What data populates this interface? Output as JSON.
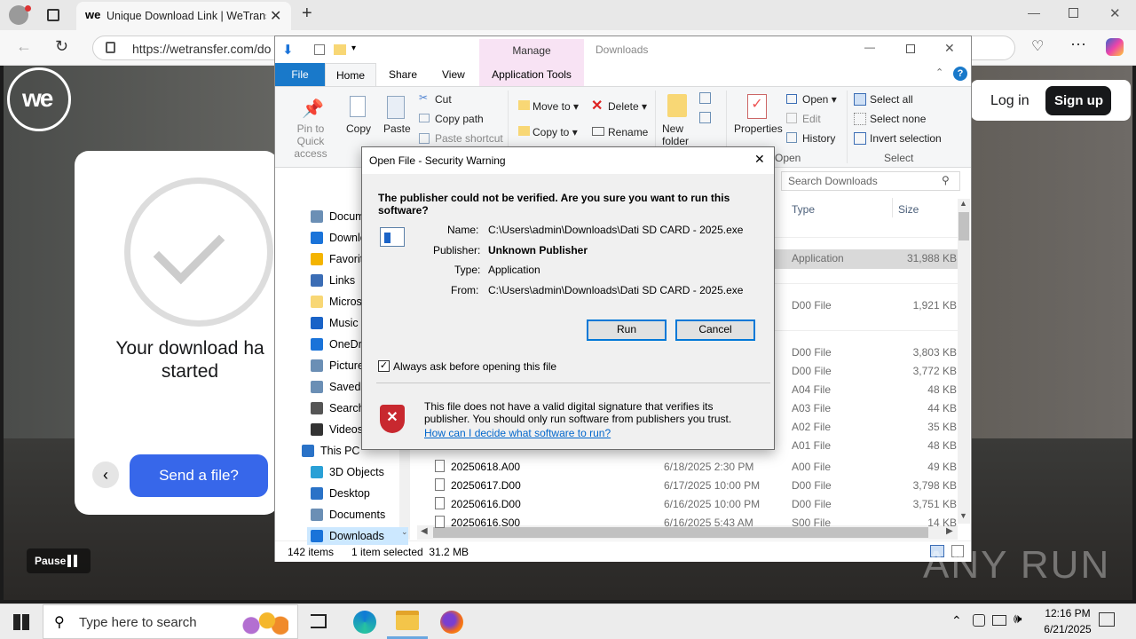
{
  "browser": {
    "tab_title": "Unique Download Link | WeTransf",
    "url": "https://wetransfer.com/do"
  },
  "wetransfer": {
    "logo_text": "we",
    "download_msg": "Your download ha\nstarted",
    "send_button": "Send a file?",
    "login": "Log in",
    "signup": "Sign up",
    "pause": "Pause"
  },
  "explorer": {
    "title": "Downloads",
    "manage": "Manage",
    "tabs": [
      "File",
      "Home",
      "Share",
      "View",
      "Application Tools"
    ],
    "ribbon": {
      "pin": "Pin to Quick\naccess",
      "copy": "Copy",
      "paste": "Paste",
      "cut": "Cut",
      "copy_path": "Copy path",
      "paste_shortcut": "Paste shortcut",
      "move_to": "Move to",
      "copy_to": "Copy to",
      "delete": "Delete",
      "rename": "Rename",
      "new_folder": "New\nfolder",
      "properties": "Properties",
      "open": "Open",
      "edit": "Edit",
      "history": "History",
      "open_group": "Open",
      "select_all": "Select all",
      "select_none": "Select none",
      "invert_selection": "Invert selection",
      "select_group": "Select"
    },
    "search_placeholder": "Search Downloads",
    "columns": {
      "type": "Type",
      "size": "Size"
    },
    "nav_items": [
      "Docum",
      "Downlo",
      "Favorit",
      "Links",
      "Micros",
      "Music",
      "OneDri",
      "Picture",
      "Saved",
      "Search",
      "Videos",
      "This PC",
      "3D Objects",
      "Desktop",
      "Documents",
      "Downloads"
    ],
    "right_rows": [
      {
        "type": "Application",
        "size": "31,988 KB"
      },
      {
        "type": "D00 File",
        "size": "1,921 KB"
      },
      {
        "type": "D00 File",
        "size": "3,803 KB"
      },
      {
        "type": "D00 File",
        "size": "3,772 KB"
      },
      {
        "type": "A04 File",
        "size": "48 KB"
      },
      {
        "type": "A03 File",
        "size": "44 KB"
      },
      {
        "type": "A02 File",
        "size": "35 KB"
      },
      {
        "type": "A01 File",
        "size": "48 KB"
      }
    ],
    "files": [
      {
        "name": "20250618.A00",
        "date": "6/18/2025 2:30 PM",
        "type": "A00 File",
        "size": "49 KB"
      },
      {
        "name": "20250617.D00",
        "date": "6/17/2025 10:00 PM",
        "type": "D00 File",
        "size": "3,798 KB"
      },
      {
        "name": "20250616.D00",
        "date": "6/16/2025 10:00 PM",
        "type": "D00 File",
        "size": "3,751 KB"
      },
      {
        "name": "20250616.S00",
        "date": "6/16/2025 5:43 AM",
        "type": "S00 File",
        "size": "14 KB"
      }
    ],
    "status_items": "142 items",
    "status_selected": "1 item selected  31.2 MB"
  },
  "dialog": {
    "title": "Open File - Security Warning",
    "question": "The publisher could not be verified.  Are you sure you want to run this software?",
    "name_label": "Name:",
    "name_value": "C:\\Users\\admin\\Downloads\\Dati SD CARD - 2025.exe",
    "publisher_label": "Publisher:",
    "publisher_value": "Unknown Publisher",
    "type_label": "Type:",
    "type_value": "Application",
    "from_label": "From:",
    "from_value": "C:\\Users\\admin\\Downloads\\Dati SD CARD - 2025.exe",
    "run": "Run",
    "cancel": "Cancel",
    "always_ask": "Always ask before opening this file",
    "warning": "This file does not have a valid digital signature that verifies its publisher.  You should only run software from publishers you trust.",
    "help_link": "How can I decide what software to run?"
  },
  "taskbar": {
    "search_placeholder": "Type here to search",
    "time": "12:16 PM",
    "date": "6/21/2025"
  },
  "watermark": "ANY RUN"
}
